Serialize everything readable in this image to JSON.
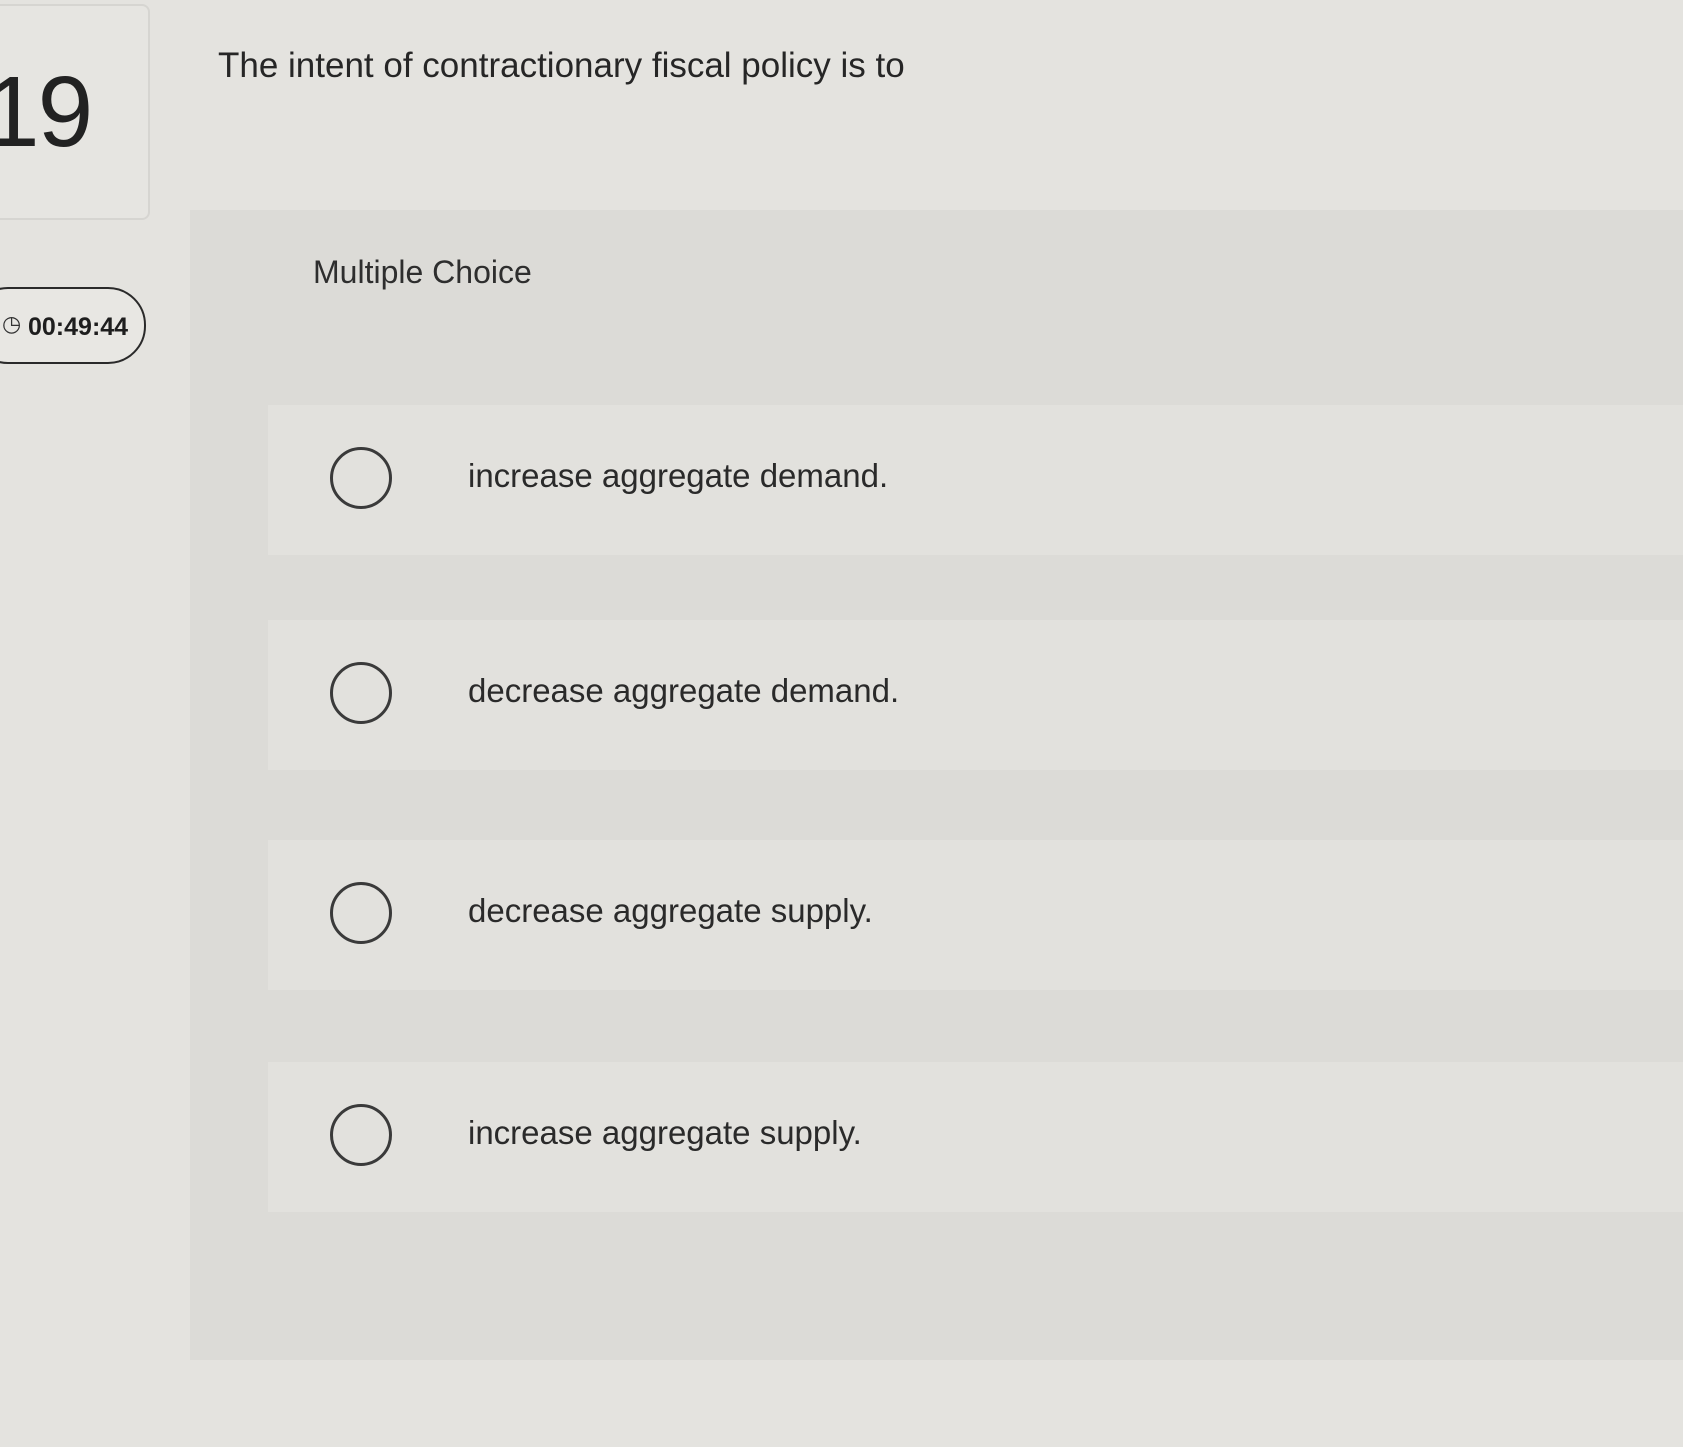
{
  "question": {
    "number": "19",
    "text": "The intent of contractionary fiscal policy is to",
    "type_label": "Multiple Choice"
  },
  "timer": {
    "value": "00:49:44",
    "icon": "clock-icon"
  },
  "options": [
    {
      "label": "increase aggregate demand."
    },
    {
      "label": "decrease aggregate demand."
    },
    {
      "label": "decrease aggregate supply."
    },
    {
      "label": "increase aggregate supply."
    }
  ]
}
